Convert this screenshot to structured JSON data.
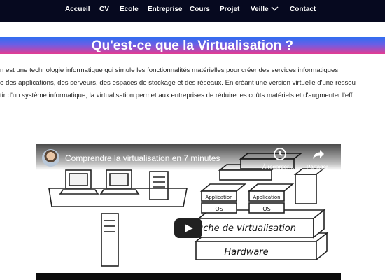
{
  "nav": {
    "items": [
      "Accueil",
      "CV",
      "Ecole",
      "Entreprise",
      "Cours",
      "Projet",
      "Veille",
      "Contact"
    ]
  },
  "page_title": "Qu'est-ce que la Virtualisation ?",
  "intro": {
    "line1": "n est une technologie informatique qui simule les fonctionnalités matérielles pour créer des services informatiques",
    "line2": "e des applications, des serveurs, des espaces de stockage et des réseaux. En créant une version virtuelle d'une ressou",
    "line3": "tir d'un système informatique, la virtualisation permet aux entreprises de réduire les coûts matériels et d'augmenter l'eff"
  },
  "video": {
    "title": "Comprendre la virtualisation en 7 minutes",
    "watch_later_label": "À regarder…",
    "share_label": "Partager",
    "illustration": {
      "app_label": "Application",
      "os_label": "OS",
      "hypervisor_label": "Couche de virtualisation",
      "hardware_label": "Hardware"
    }
  },
  "colors": {
    "nav_bg": "#06091f",
    "title_gradient": [
      "#2f6ef0",
      "#6a5fe6",
      "#e23c93"
    ]
  },
  "icons": {
    "veille_dropdown": "chevron-down-icon",
    "watch_later": "clock-icon",
    "share": "share-icon",
    "play": "play-icon"
  }
}
